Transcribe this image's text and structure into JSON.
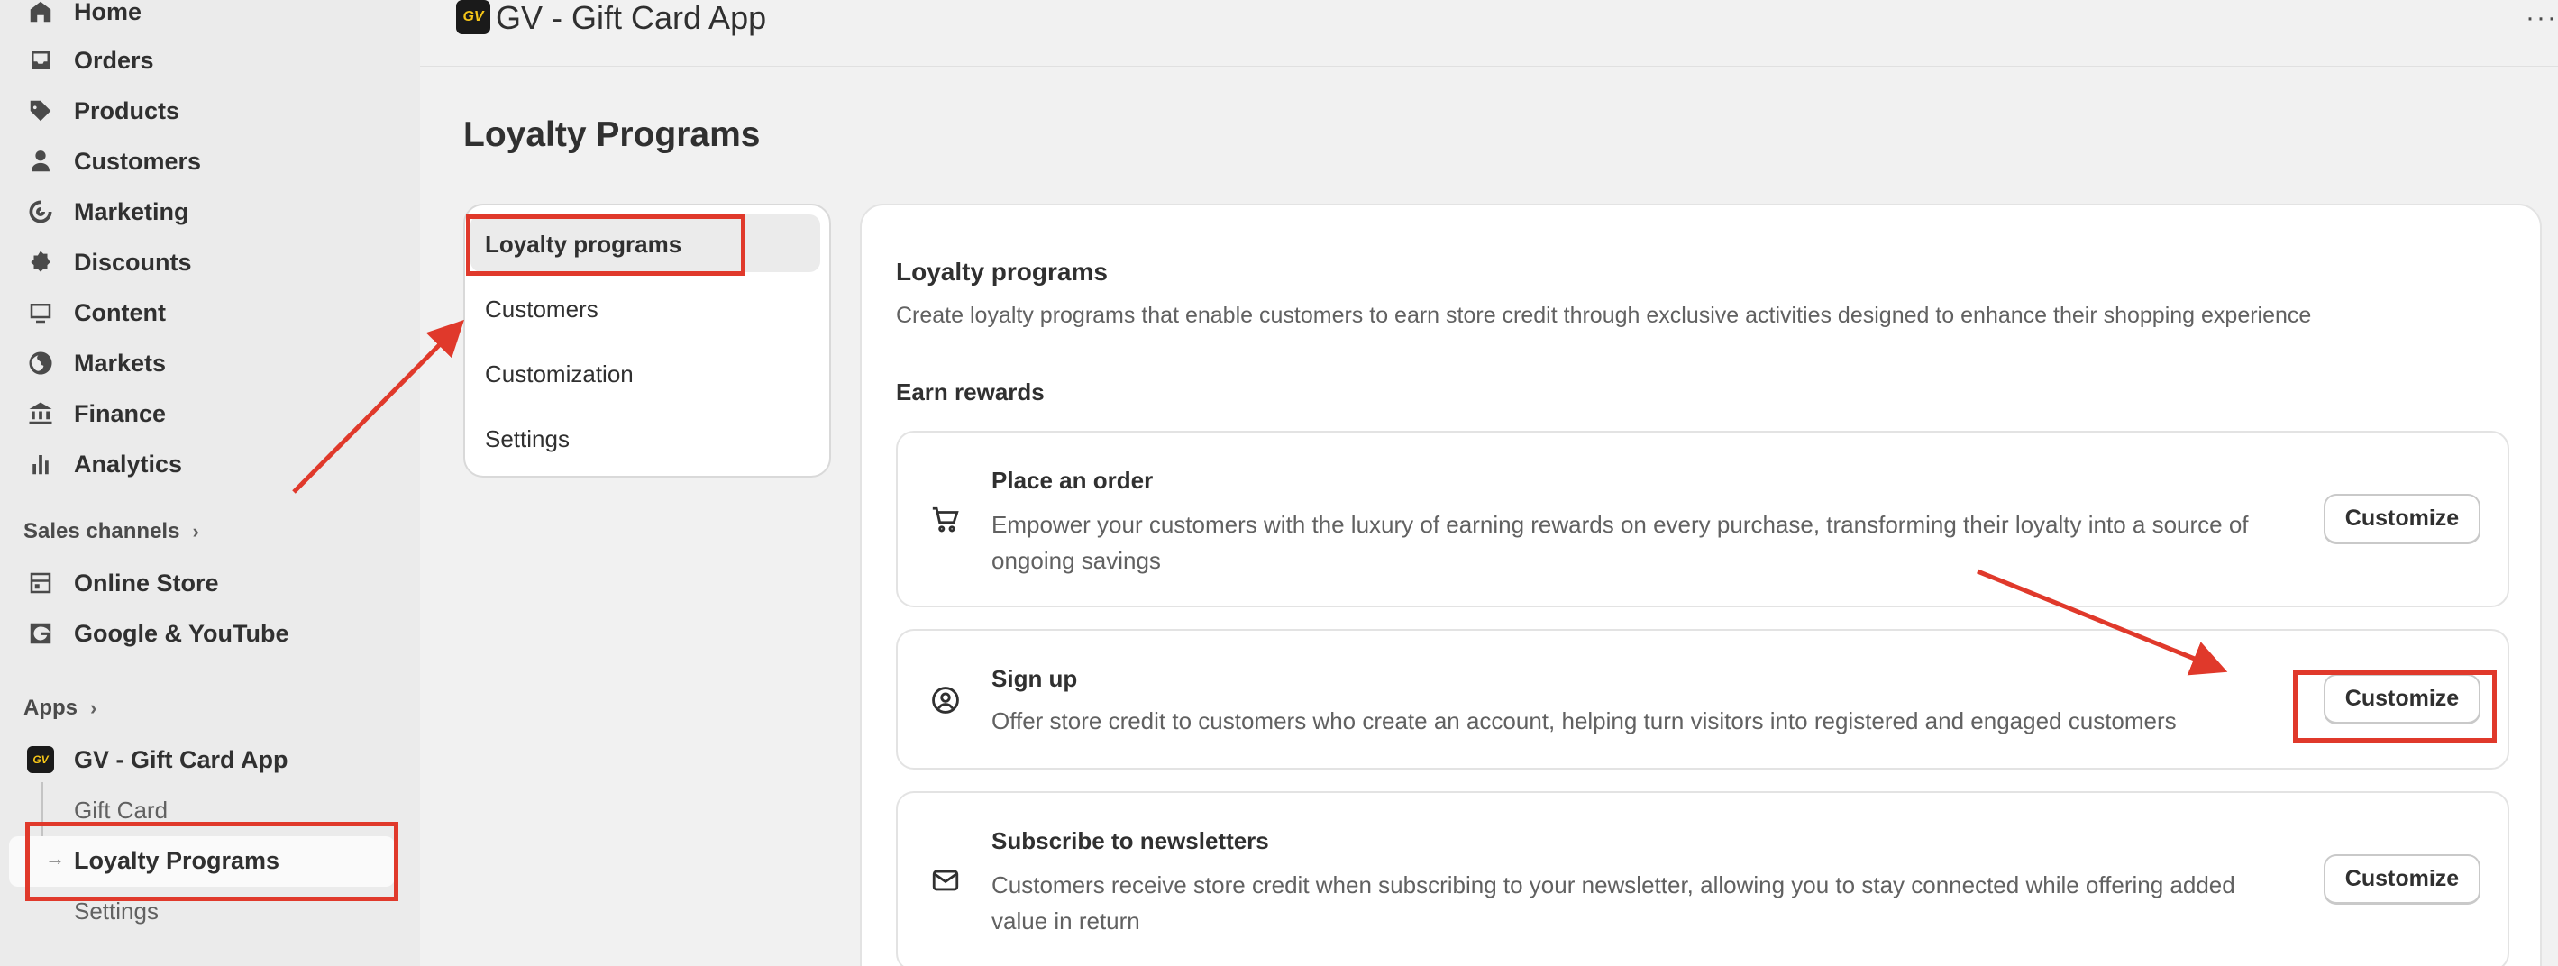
{
  "sidebar": {
    "items": [
      {
        "label": "Home",
        "icon": "home-icon"
      },
      {
        "label": "Orders",
        "icon": "inbox-icon"
      },
      {
        "label": "Products",
        "icon": "tag-icon"
      },
      {
        "label": "Customers",
        "icon": "person-icon"
      },
      {
        "label": "Marketing",
        "icon": "target-icon"
      },
      {
        "label": "Discounts",
        "icon": "discount-icon"
      },
      {
        "label": "Content",
        "icon": "content-icon"
      },
      {
        "label": "Markets",
        "icon": "globe-icon"
      },
      {
        "label": "Finance",
        "icon": "bank-icon"
      },
      {
        "label": "Analytics",
        "icon": "bar-chart-icon"
      }
    ],
    "sales_channels": {
      "label": "Sales channels",
      "items": [
        {
          "label": "Online Store",
          "icon": "store-icon"
        },
        {
          "label": "Google & YouTube",
          "icon": "google-icon"
        }
      ]
    },
    "apps": {
      "label": "Apps",
      "app_name": "GV - Gift Card App",
      "app_logo_text": "GV",
      "sub_items": [
        "Gift Card",
        "Loyalty Programs",
        "Settings"
      ],
      "active_sub_item": "Loyalty Programs"
    }
  },
  "topbar": {
    "logo_text": "GV",
    "title": "GV - Gift Card App",
    "more": "···"
  },
  "page": {
    "title": "Loyalty Programs"
  },
  "submenu": {
    "items": [
      "Loyalty programs",
      "Customers",
      "Customization",
      "Settings"
    ],
    "active": "Loyalty programs"
  },
  "main": {
    "title": "Loyalty programs",
    "description": "Create loyalty programs that enable customers to earn store credit through exclusive activities designed to enhance their shopping experience",
    "earn_title": "Earn rewards",
    "rewards": [
      {
        "title": "Place an order",
        "description": "Empower your customers with the luxury of earning rewards on every purchase, transforming their loyalty into a source of ongoing savings",
        "button": "Customize",
        "icon": "cart-icon"
      },
      {
        "title": "Sign up",
        "description": "Offer store credit to customers who create an account, helping turn visitors into registered and engaged customers",
        "button": "Customize",
        "icon": "user-circle-icon"
      },
      {
        "title": "Subscribe to newsletters",
        "description": "Customers receive store credit when subscribing to your newsletter, allowing you to stay connected while offering added value in return",
        "button": "Customize",
        "icon": "envelope-icon"
      }
    ]
  },
  "colors": {
    "annotation_red": "#e0392b",
    "sidebar_bg": "#ebebeb",
    "page_bg": "#f1f1f1",
    "card_bg": "#ffffff"
  }
}
